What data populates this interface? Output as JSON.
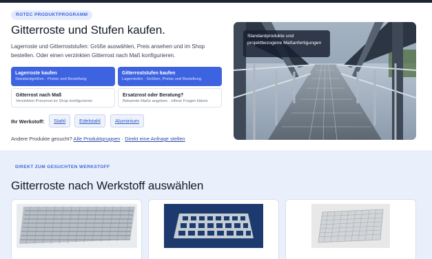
{
  "hero": {
    "badge": "ROTEC PRODUKTPROGRAMM",
    "title": "Gitterroste und Stufen kaufen.",
    "description": "Lagerroste und Gitterroststufen: Größe auswählen, Preis ansehen und im Shop bestellen. Oder einen verzinkten Gitterrost nach Maß konfigurieren.",
    "cards": [
      {
        "title": "Lagerroste kaufen",
        "subtitle": "Standardgrößen · Preise und Bestellung",
        "style": "primary"
      },
      {
        "title": "Gitterroststufen kaufen",
        "subtitle": "Lagerstufen · Größen, Preise und Bestellung",
        "style": "primary"
      },
      {
        "title": "Gitterrost nach Maß",
        "subtitle": "Verzinkten Pressrost im Shop konfigurieren",
        "style": "secondary"
      },
      {
        "title": "Ersatzrost oder Beratung?",
        "subtitle": "Bekannte Maße angeben · offene Fragen klären",
        "style": "secondary"
      }
    ],
    "material_label": "Ihr Werkstoff:",
    "materials": [
      "Stahl",
      "Edelstahl",
      "Aluminium"
    ],
    "other_prefix": "Andere Produkte gesucht?",
    "other_link_1": "Alle Produktgruppen",
    "other_sep": "·",
    "other_link_2": "Direkt eine Anfrage stellen",
    "photo_caption": "Standardprodukte und projektbezogene Maßanfertigungen"
  },
  "section": {
    "kicker": "DIREKT ZUM GESUCHTEN WERKSTOFF",
    "title": "Gitterroste nach Werkstoff auswählen",
    "products": [
      {
        "image": "steel-grating-image"
      },
      {
        "image": "stainless-grating-image"
      },
      {
        "image": "aluminium-grating-image"
      }
    ]
  },
  "colors": {
    "accent": "#3d63e0",
    "section_bg": "#eaf0fb",
    "topbar": "#1c2333"
  }
}
